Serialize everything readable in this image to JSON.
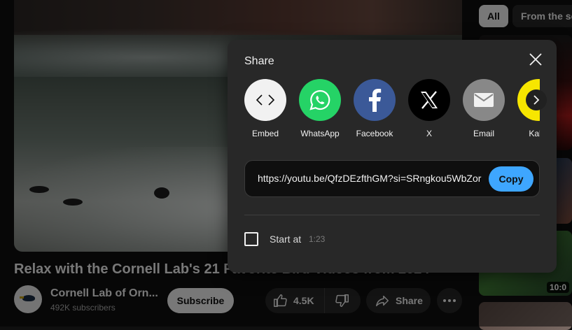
{
  "video": {
    "title": "Relax with the Cornell Lab's 21 Favorite Bird Videos from 2024",
    "channel_name": "Cornell Lab of Orn...",
    "subscribers": "492K subscribers",
    "subscribe_label": "Subscribe",
    "like_count": "4.5K",
    "share_label": "Share"
  },
  "chips": {
    "all_label": "All",
    "series_label": "From the se"
  },
  "related": [
    {
      "duration": ""
    },
    {
      "duration": ""
    },
    {
      "duration": ""
    },
    {
      "duration": "10:0"
    }
  ],
  "share_dialog": {
    "title": "Share",
    "targets": [
      {
        "label": "Embed",
        "icon": "embed-icon",
        "color": "#f1f1f1"
      },
      {
        "label": "WhatsApp",
        "icon": "whatsapp-icon",
        "color": "#25d366"
      },
      {
        "label": "Facebook",
        "icon": "facebook-icon",
        "color": "#3b5998"
      },
      {
        "label": "X",
        "icon": "x-icon",
        "color": "#000000"
      },
      {
        "label": "Email",
        "icon": "email-icon",
        "color": "#888888"
      },
      {
        "label": "Kaka",
        "icon": "kakaotalk-icon",
        "color": "#f7e600"
      }
    ],
    "url": "https://youtu.be/QfzDEzfthGM?si=SRngkou5WbZor",
    "copy_label": "Copy",
    "start_at_label": "Start at",
    "start_at_time": "1:23"
  },
  "colors": {
    "copy_accent": "#3ea6ff"
  }
}
